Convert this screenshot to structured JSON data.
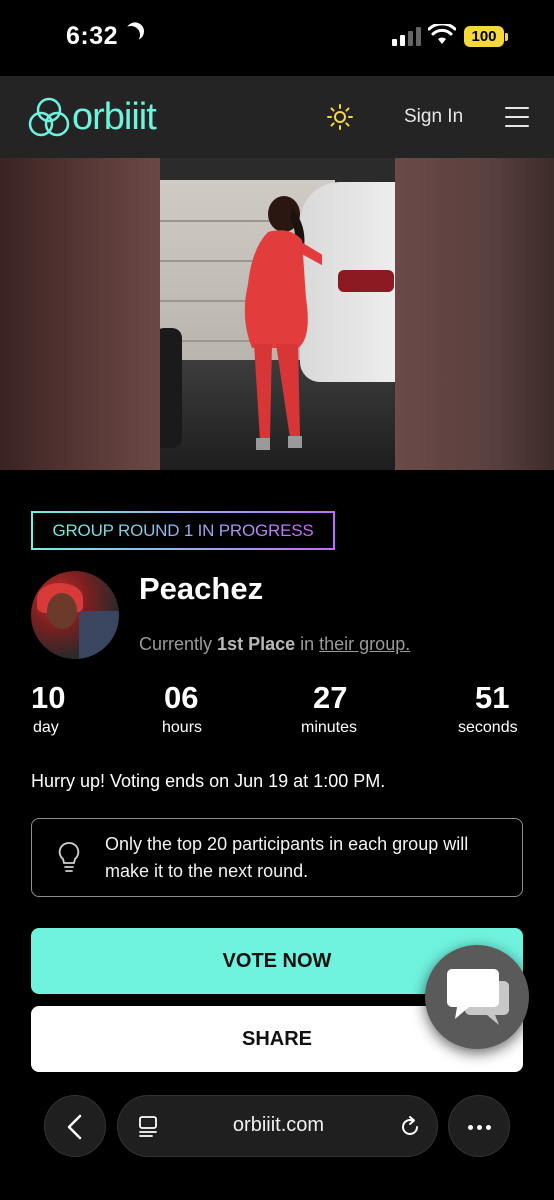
{
  "status_bar": {
    "time": "6:32",
    "battery": "100"
  },
  "header": {
    "logo_text": "orbiiit",
    "sign_in": "Sign In",
    "icons": [
      "sun-icon",
      "menu-icon"
    ]
  },
  "contest": {
    "round_badge": "GROUP ROUND 1 IN PROGRESS",
    "participant_name": "Peachez",
    "place_prefix": "Currently",
    "place_value": "1st Place",
    "place_mid": "in",
    "place_link": "their group."
  },
  "countdown": {
    "days": "10",
    "days_label": "day",
    "hours": "06",
    "hours_label": "hours",
    "minutes": "27",
    "minutes_label": "minutes",
    "seconds": "51",
    "seconds_label": "seconds"
  },
  "voting_notice": "Hurry up!  Voting ends on Jun 19 at 1:00 PM.",
  "info_tip": "Only the top 20 participants in each group will make it to the next round.",
  "actions": {
    "vote": "VOTE NOW",
    "share": "SHARE"
  },
  "browser": {
    "url": "orbiiit.com"
  },
  "colors": {
    "accent": "#6ff2de",
    "gradient_end": "#c86bff",
    "header_bg": "#242424",
    "battery": "#f5d93a"
  }
}
